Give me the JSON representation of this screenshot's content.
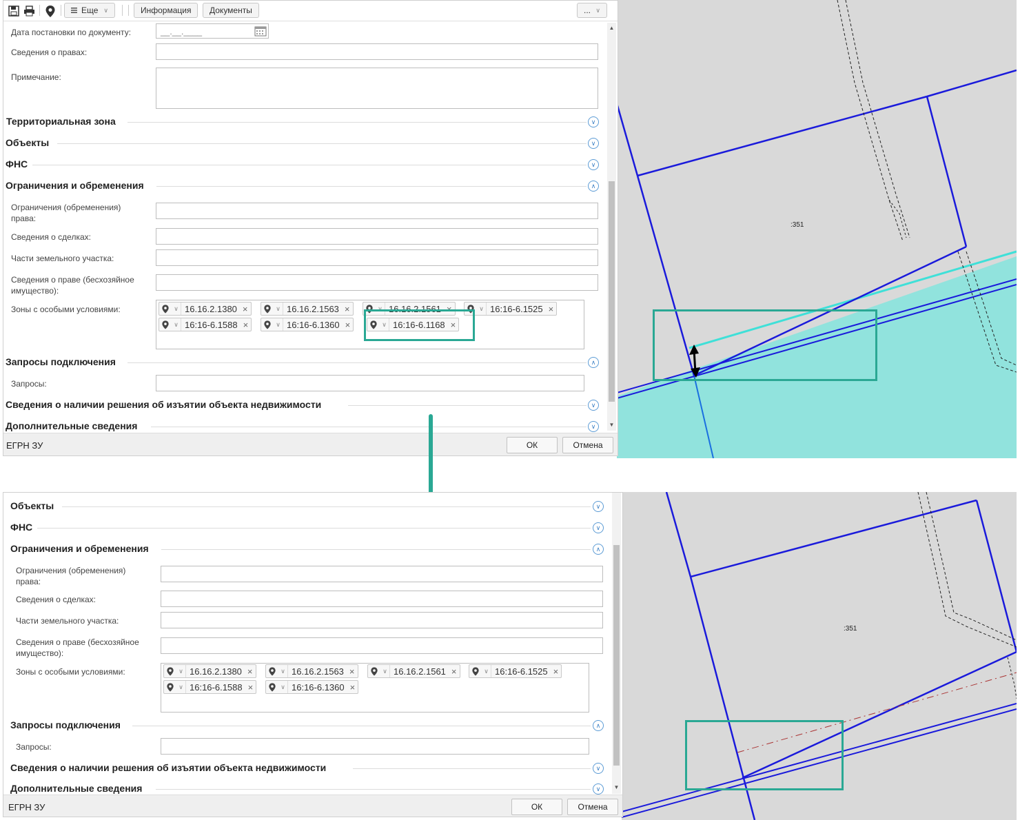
{
  "top": {
    "toolbar": {
      "more_label": "Еще",
      "info_label": "Информация",
      "docs_label": "Документы",
      "ellipsis_label": "..."
    },
    "fields": {
      "doc_date_label": "Дата постановки по документу:",
      "doc_date_placeholder": "__.__.____",
      "rights_label": "Сведения о правах:",
      "note_label": "Примечание:"
    },
    "sections": {
      "territorial_zone": "Территориальная зона",
      "objects": "Объекты",
      "fns": "ФНС",
      "restrictions": "Ограничения и обременения",
      "requests": "Запросы подключения",
      "seizure": "Сведения о наличии решения об изъятии объекта недвижимости",
      "additional": "Дополнительные сведения"
    },
    "restrictions": {
      "restrictions_label_1": "Ограничения (обременения)",
      "restrictions_label_2": "права:",
      "deals_label": "Сведения о сделках:",
      "parts_label": "Части земельного участка:",
      "ownerless_label_1": "Сведения о праве (бесхозяйное",
      "ownerless_label_2": "имущество):",
      "zones_label": "Зоны с особыми условиями:"
    },
    "zones": [
      "16.16.2.1380",
      "16.16.2.1563",
      "16.16.2.1561",
      "16:16-6.1525",
      "16:16-6.1588",
      "16:16-6.1360",
      "16:16-6.1168"
    ],
    "requests_label": "Запросы:",
    "footer": {
      "title": "ЕГРН ЗУ",
      "ok": "ОК",
      "cancel": "Отмена"
    },
    "map_parcel_label": ":351"
  },
  "bottom": {
    "sections": {
      "objects": "Объекты",
      "fns": "ФНС",
      "restrictions": "Ограничения и обременения",
      "requests": "Запросы подключения",
      "seizure": "Сведения о наличии решения об изъятии объекта недвижимости",
      "additional": "Дополнительные сведения"
    },
    "restrictions": {
      "restrictions_label_1": "Ограничения (обременения)",
      "restrictions_label_2": "права:",
      "deals_label": "Сведения о сделках:",
      "parts_label": "Части земельного участка:",
      "ownerless_label_1": "Сведения о праве (бесхозяйное",
      "ownerless_label_2": "имущество):",
      "zones_label": "Зоны с особыми условиями:"
    },
    "zones": [
      "16.16.2.1380",
      "16.16.2.1563",
      "16.16.2.1561",
      "16:16-6.1525",
      "16:16-6.1588",
      "16:16-6.1360"
    ],
    "requests_label": "Запросы:",
    "footer": {
      "title": "ЕГРН ЗУ",
      "ok": "ОК",
      "cancel": "Отмена"
    },
    "map_parcel_label": ":351"
  },
  "colors": {
    "accent_highlight": "#2aa894",
    "parcel_line": "#1a1adb",
    "zone_fill": "#91e3dd",
    "zone_edge": "#3fe0d8"
  }
}
